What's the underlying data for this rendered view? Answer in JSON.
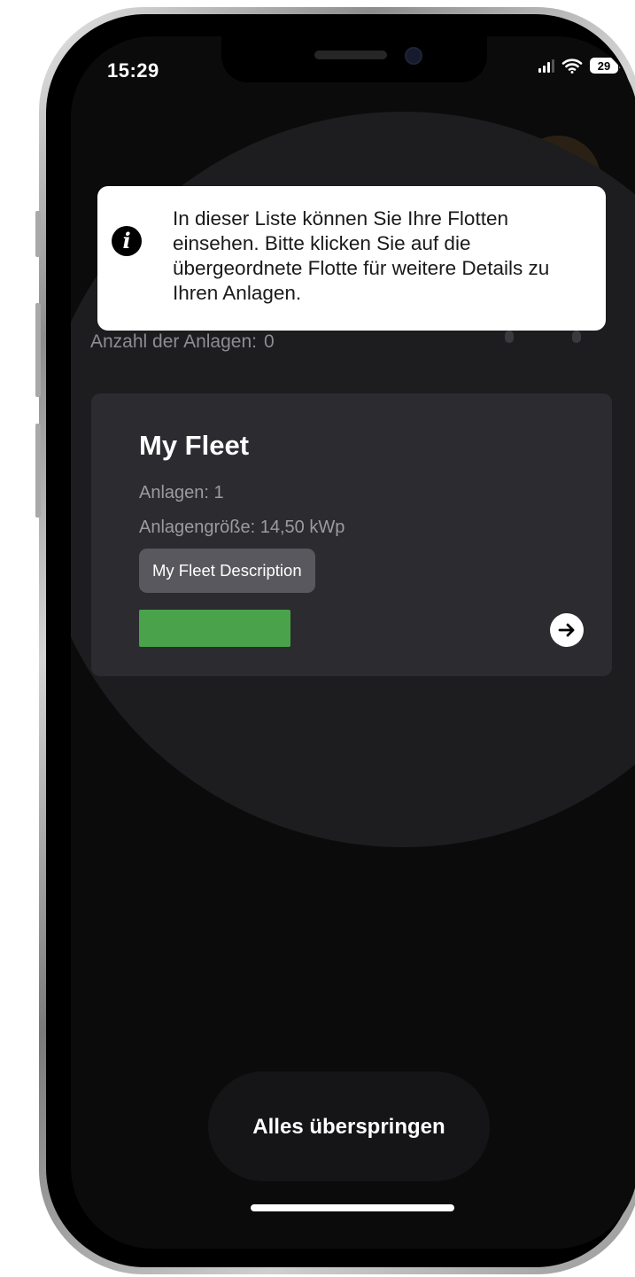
{
  "status_bar": {
    "time": "15:29",
    "battery_level": "29",
    "icons": [
      "signal-icon",
      "wifi-icon",
      "battery-icon"
    ]
  },
  "fleet_list": {
    "count_label": "Anzahl der Anlagen:",
    "count_value": "0"
  },
  "tooltip": {
    "icon": "info-icon",
    "text": "In dieser Liste können Sie Ihre Flotten einsehen. Bitte klicken Sie auf die übergeordnete Flotte für weitere Details zu Ihren Anlagen."
  },
  "fleet_card": {
    "title": "My Fleet",
    "plants": "Anlagen: 1",
    "plant_size": "Anlagengröße: 14,50 kWp",
    "description": "My Fleet Description",
    "progress_fraction": 1.0,
    "progress_color": "#4aa24a",
    "arrow_icon": "arrow-right-circle-icon"
  },
  "actions": {
    "skip_label": "Alles überspringen"
  },
  "colors": {
    "screen_background": "#0b0b0c",
    "card_background": "#2b2b30",
    "tooltip_background": "#ffffff",
    "brand_accent": "#c2852d"
  }
}
